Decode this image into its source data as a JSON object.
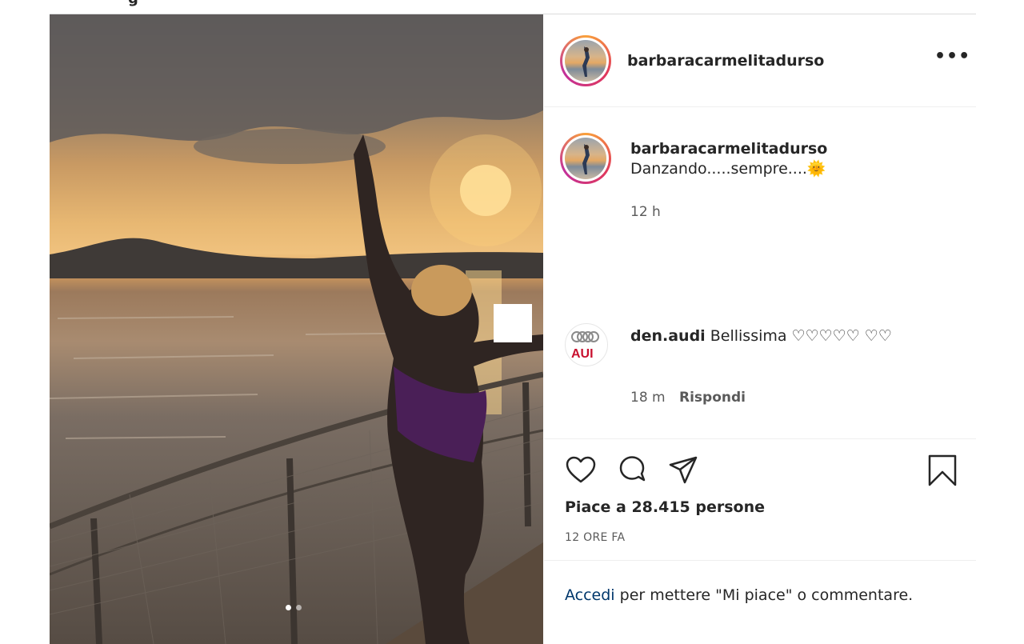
{
  "header": {
    "title_fragment": "g"
  },
  "post": {
    "username": "barbaracarmelitadurso",
    "caption": "Danzando.....sempre....🌞",
    "caption_time": "12 h",
    "slide_dots": 2
  },
  "comment": {
    "username": "den.audi",
    "text": "Bellissima ♡♡♡♡♡ ♡♡",
    "time": "18 m",
    "reply_label": "Rispondi"
  },
  "actions": {
    "like_icon": "heart-icon",
    "comment_icon": "comment-icon",
    "share_icon": "send-icon",
    "save_icon": "bookmark-icon"
  },
  "likes": "Piace a 28.415 persone",
  "time_ago": "12 ORE FA",
  "login": {
    "link": "Accedi",
    "rest": " per mettere \"Mi piace\" o commentare."
  },
  "colors": {
    "link": "#00376b",
    "ring_start": "#f9a13b",
    "ring_end": "#c2309a"
  }
}
